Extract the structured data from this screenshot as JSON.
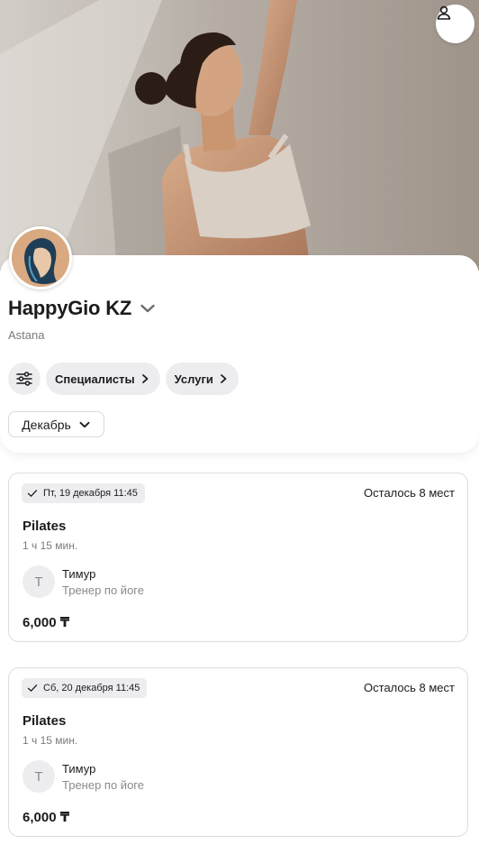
{
  "header": {
    "account_icon": "user-icon",
    "studio_name": "HappyGio KZ",
    "city": "Astana",
    "expand_icon": "chevron-down-icon"
  },
  "filters": {
    "settings_icon": "sliders-icon",
    "chips": [
      {
        "label": "Специалисты"
      },
      {
        "label": "Услуги"
      }
    ],
    "month": "Декабрь"
  },
  "sessions": [
    {
      "date": "Пт, 19 декабря 11:45",
      "spots_left": "Осталось 8 мест",
      "class_name": "Pilates",
      "duration": "1 ч 15 мин.",
      "trainer_initial": "Т",
      "trainer_name": "Тимур",
      "trainer_role": "Тренер по йоге",
      "price": "6,000 ₸"
    },
    {
      "date": "Сб, 20 декабря 11:45",
      "spots_left": "Осталось 8 мест",
      "class_name": "Pilates",
      "duration": "1 ч 15 мин.",
      "trainer_initial": "Т",
      "trainer_name": "Тимур",
      "trainer_role": "Тренер по йоге",
      "price": "6,000 ₸"
    }
  ],
  "colors": {
    "chip_bg": "#ededef",
    "text_primary": "#1c1c1e",
    "text_secondary": "#7a7a7e"
  }
}
